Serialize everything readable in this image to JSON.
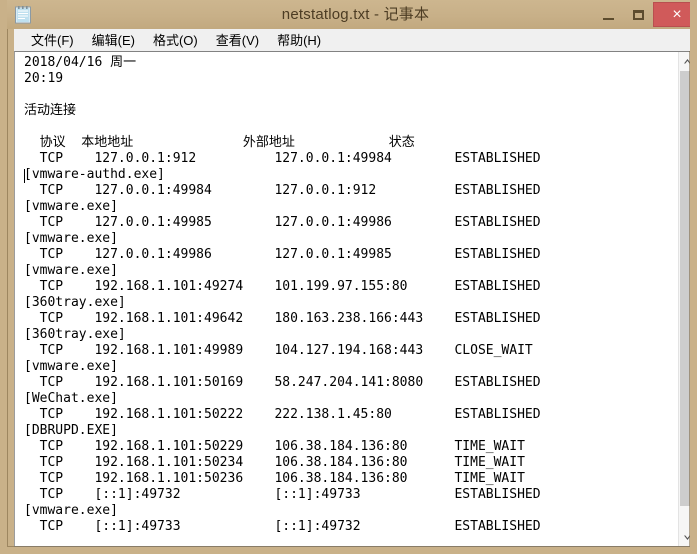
{
  "window": {
    "title": "netstatlog.txt - 记事本",
    "icon": "notepad-icon",
    "frame_color": "#c9b189",
    "titlebar_text_color": "#4c3c23",
    "close_button_color": "#d05a5a"
  },
  "caption_buttons": {
    "minimize_label": "最小化",
    "maximize_label": "最大化",
    "close_label": "×"
  },
  "menu": {
    "items": [
      {
        "label": "文件(F)",
        "name": "menu-file"
      },
      {
        "label": "编辑(E)",
        "name": "menu-edit"
      },
      {
        "label": "格式(O)",
        "name": "menu-format"
      },
      {
        "label": "查看(V)",
        "name": "menu-view"
      },
      {
        "label": "帮助(H)",
        "name": "menu-help"
      }
    ]
  },
  "document": {
    "date_line": "2018/04/16 周一",
    "time_line": "20:19",
    "section_title": "活动连接",
    "columns": [
      "协议",
      "本地地址",
      "外部地址",
      "状态"
    ],
    "header_line": "  协议  本地地址              外部地址            状态",
    "connections": [
      {
        "proto": "TCP",
        "local": "127.0.0.1:912",
        "foreign": "127.0.0.1:49984",
        "state": "ESTABLISHED",
        "process": "[vmware-authd.exe]"
      },
      {
        "proto": "TCP",
        "local": "127.0.0.1:49984",
        "foreign": "127.0.0.1:912",
        "state": "ESTABLISHED",
        "process": "[vmware.exe]"
      },
      {
        "proto": "TCP",
        "local": "127.0.0.1:49985",
        "foreign": "127.0.0.1:49986",
        "state": "ESTABLISHED",
        "process": "[vmware.exe]"
      },
      {
        "proto": "TCP",
        "local": "127.0.0.1:49986",
        "foreign": "127.0.0.1:49985",
        "state": "ESTABLISHED",
        "process": "[vmware.exe]"
      },
      {
        "proto": "TCP",
        "local": "192.168.1.101:49274",
        "foreign": "101.199.97.155:80",
        "state": "ESTABLISHED",
        "process": "[360tray.exe]"
      },
      {
        "proto": "TCP",
        "local": "192.168.1.101:49642",
        "foreign": "180.163.238.166:443",
        "state": "ESTABLISHED",
        "process": "[360tray.exe]"
      },
      {
        "proto": "TCP",
        "local": "192.168.1.101:49989",
        "foreign": "104.127.194.168:443",
        "state": "CLOSE_WAIT",
        "process": "[vmware.exe]"
      },
      {
        "proto": "TCP",
        "local": "192.168.1.101:50169",
        "foreign": "58.247.204.141:8080",
        "state": "ESTABLISHED",
        "process": "[WeChat.exe]"
      },
      {
        "proto": "TCP",
        "local": "192.168.1.101:50222",
        "foreign": "222.138.1.45:80",
        "state": "ESTABLISHED",
        "process": "[DBRUPD.EXE]"
      },
      {
        "proto": "TCP",
        "local": "192.168.1.101:50229",
        "foreign": "106.38.184.136:80",
        "state": "TIME_WAIT",
        "process": ""
      },
      {
        "proto": "TCP",
        "local": "192.168.1.101:50234",
        "foreign": "106.38.184.136:80",
        "state": "TIME_WAIT",
        "process": ""
      },
      {
        "proto": "TCP",
        "local": "192.168.1.101:50236",
        "foreign": "106.38.184.136:80",
        "state": "TIME_WAIT",
        "process": ""
      },
      {
        "proto": "TCP",
        "local": "[::1]:49732",
        "foreign": "[::1]:49733",
        "state": "ESTABLISHED",
        "process": "[vmware.exe]"
      },
      {
        "proto": "TCP",
        "local": "[::1]:49733",
        "foreign": "[::1]:49732",
        "state": "ESTABLISHED",
        "process": ""
      }
    ],
    "body": "2018/04/16 周一\n20:19\n\n活动连接\n\n  协议  本地地址              外部地址            状态\n  TCP    127.0.0.1:912          127.0.0.1:49984        ESTABLISHED\n[vmware-authd.exe]\n  TCP    127.0.0.1:49984        127.0.0.1:912          ESTABLISHED\n[vmware.exe]\n  TCP    127.0.0.1:49985        127.0.0.1:49986        ESTABLISHED\n[vmware.exe]\n  TCP    127.0.0.1:49986        127.0.0.1:49985        ESTABLISHED\n[vmware.exe]\n  TCP    192.168.1.101:49274    101.199.97.155:80      ESTABLISHED\n[360tray.exe]\n  TCP    192.168.1.101:49642    180.163.238.166:443    ESTABLISHED\n[360tray.exe]\n  TCP    192.168.1.101:49989    104.127.194.168:443    CLOSE_WAIT\n[vmware.exe]\n  TCP    192.168.1.101:50169    58.247.204.141:8080    ESTABLISHED\n[WeChat.exe]\n  TCP    192.168.1.101:50222    222.138.1.45:80        ESTABLISHED\n[DBRUPD.EXE]\n  TCP    192.168.1.101:50229    106.38.184.136:80      TIME_WAIT\n  TCP    192.168.1.101:50234    106.38.184.136:80      TIME_WAIT\n  TCP    192.168.1.101:50236    106.38.184.136:80      TIME_WAIT\n  TCP    [::1]:49732            [::1]:49733            ESTABLISHED\n[vmware.exe]\n  TCP    [::1]:49733            [::1]:49732            ESTABLISHED"
  },
  "scrollbar": {
    "up_arrow": "scroll-up-icon",
    "down_arrow": "scroll-down-icon",
    "thumb": "scroll-thumb"
  }
}
